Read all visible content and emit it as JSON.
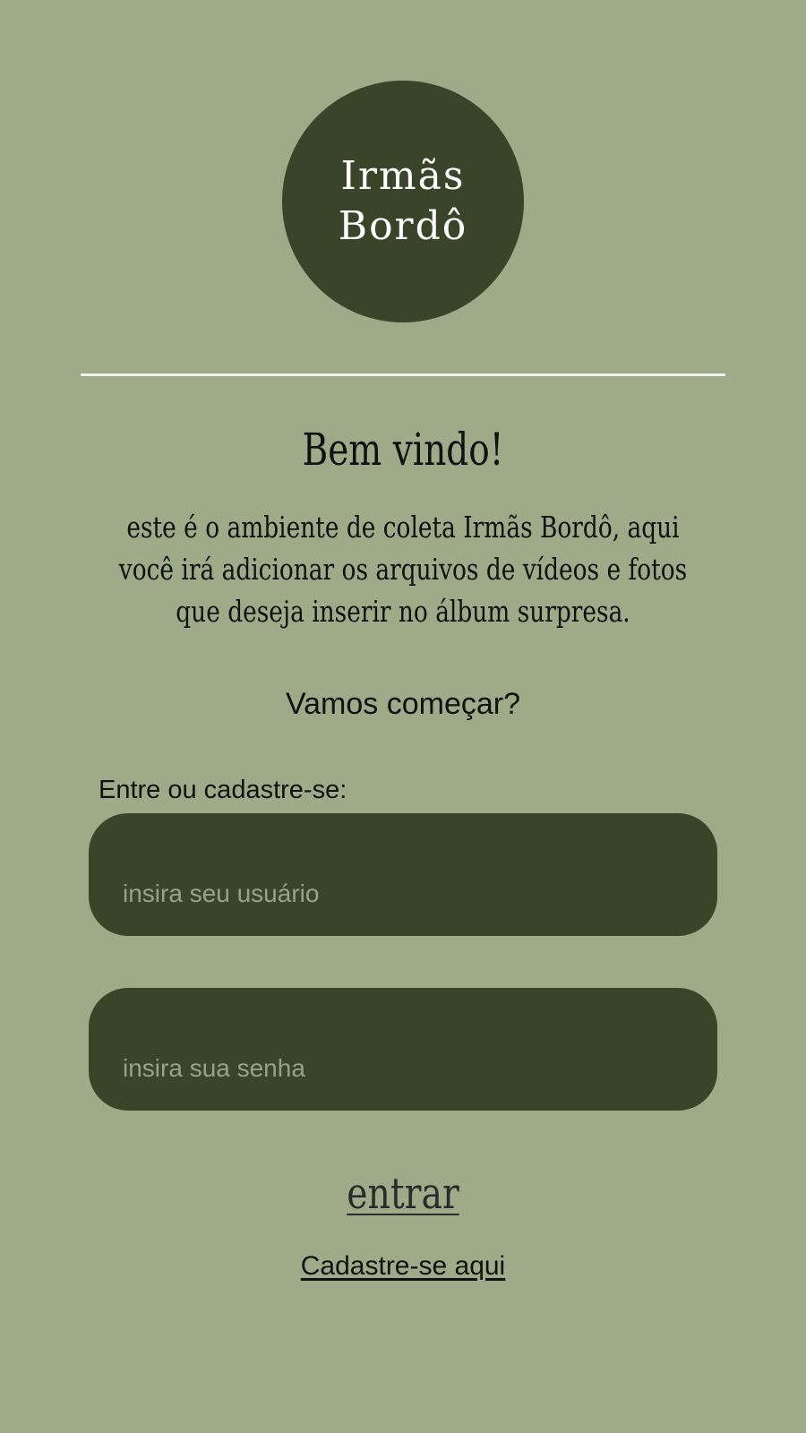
{
  "brand": {
    "line1": "Irmãs",
    "line2": "Bordô"
  },
  "welcome": {
    "title": "Bem vindo!",
    "description": "este é o ambiente de coleta Irmãs Bordô, aqui você irá adicionar os arquivos de vídeos e fotos que deseja inserir no álbum surpresa."
  },
  "cta": {
    "text": "Vamos começar?"
  },
  "login": {
    "label": "Entre ou cadastre-se:",
    "username_placeholder": "insira seu usuário",
    "password_placeholder": "insira sua senha",
    "enter_label": "entrar",
    "signup_label": "Cadastre-se aqui "
  },
  "colors": {
    "background": "#9eaa88",
    "dark_green": "#3a4428",
    "placeholder": "#98a28a",
    "divider": "#f2f2f2"
  }
}
